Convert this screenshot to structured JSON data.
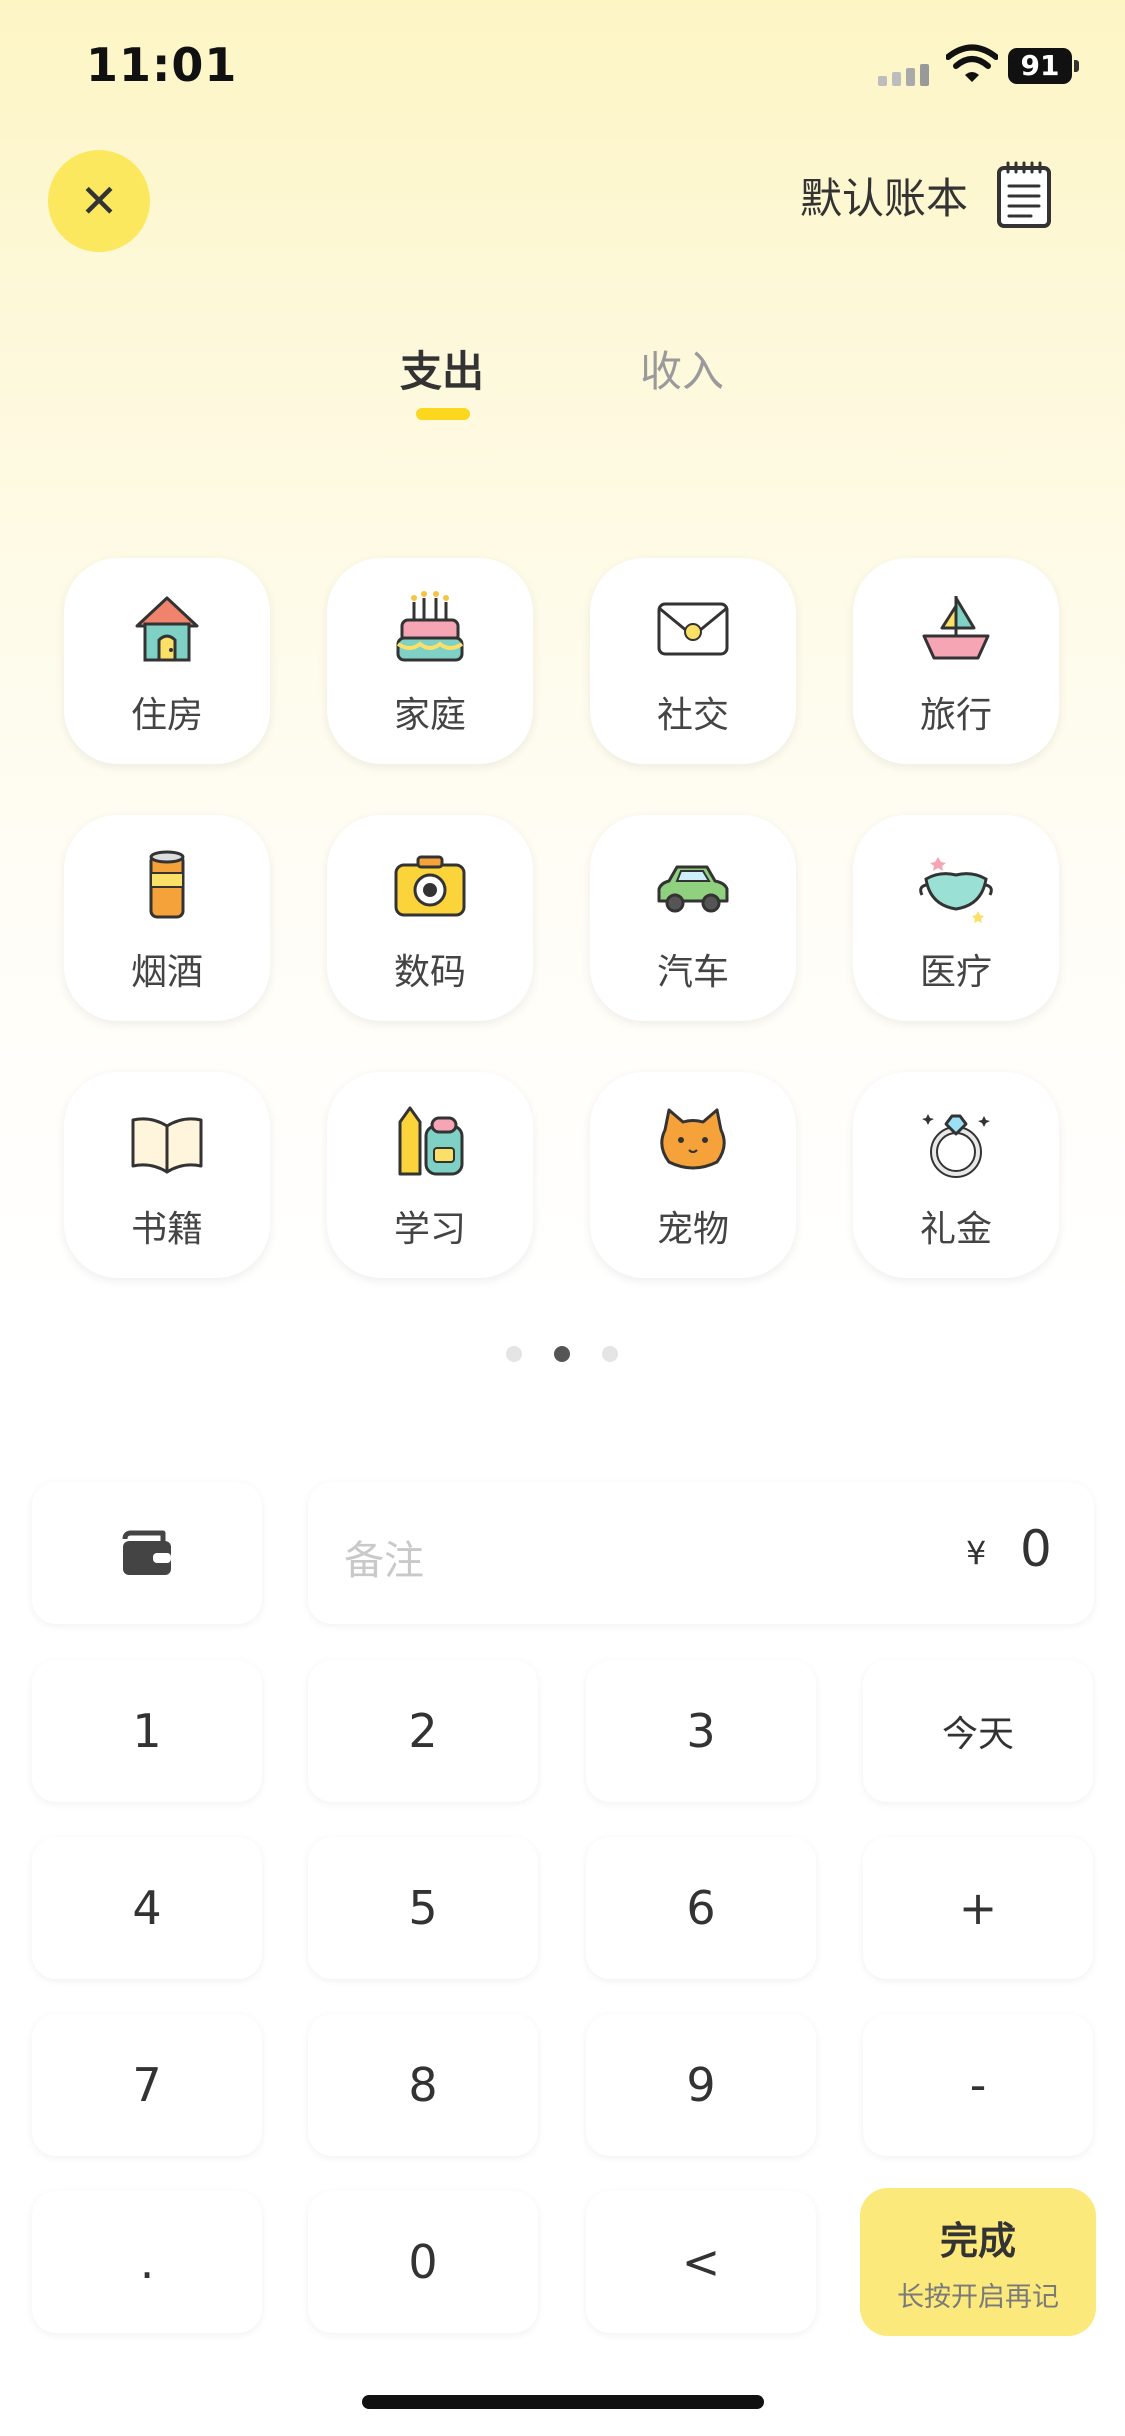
{
  "status_bar": {
    "time": "11:01",
    "battery": "91"
  },
  "header": {
    "close_icon": "close-icon",
    "book_label": "默认账本",
    "book_icon": "notepad-icon"
  },
  "tabs": [
    {
      "label": "支出",
      "active": true
    },
    {
      "label": "收入",
      "active": false
    }
  ],
  "categories": [
    {
      "label": "住房",
      "icon": "house-icon"
    },
    {
      "label": "家庭",
      "icon": "birthday-cake-icon"
    },
    {
      "label": "社交",
      "icon": "envelope-icon"
    },
    {
      "label": "旅行",
      "icon": "sailboat-icon"
    },
    {
      "label": "烟酒",
      "icon": "can-icon"
    },
    {
      "label": "数码",
      "icon": "camera-icon"
    },
    {
      "label": "汽车",
      "icon": "car-icon"
    },
    {
      "label": "医疗",
      "icon": "mask-icon"
    },
    {
      "label": "书籍",
      "icon": "book-icon"
    },
    {
      "label": "学习",
      "icon": "pencil-backpack-icon"
    },
    {
      "label": "宠物",
      "icon": "cat-icon"
    },
    {
      "label": "礼金",
      "icon": "ring-icon"
    }
  ],
  "pager": {
    "count": 3,
    "active": 2
  },
  "entry": {
    "wallet_icon": "wallet-icon",
    "note_placeholder": "备注",
    "currency": "¥",
    "amount": "0"
  },
  "keypad": {
    "k1": "1",
    "k2": "2",
    "k3": "3",
    "today": "今天",
    "k4": "4",
    "k5": "5",
    "k6": "6",
    "plus": "+",
    "k7": "7",
    "k8": "8",
    "k9": "9",
    "minus": "-",
    "dot": ".",
    "k0": "0",
    "back": "<",
    "done": "完成",
    "done_hint": "长按开启再记"
  },
  "colors": {
    "accent": "#fbe85f",
    "done_bg": "#fbe97b",
    "tab_underline": "#fbd71e"
  }
}
